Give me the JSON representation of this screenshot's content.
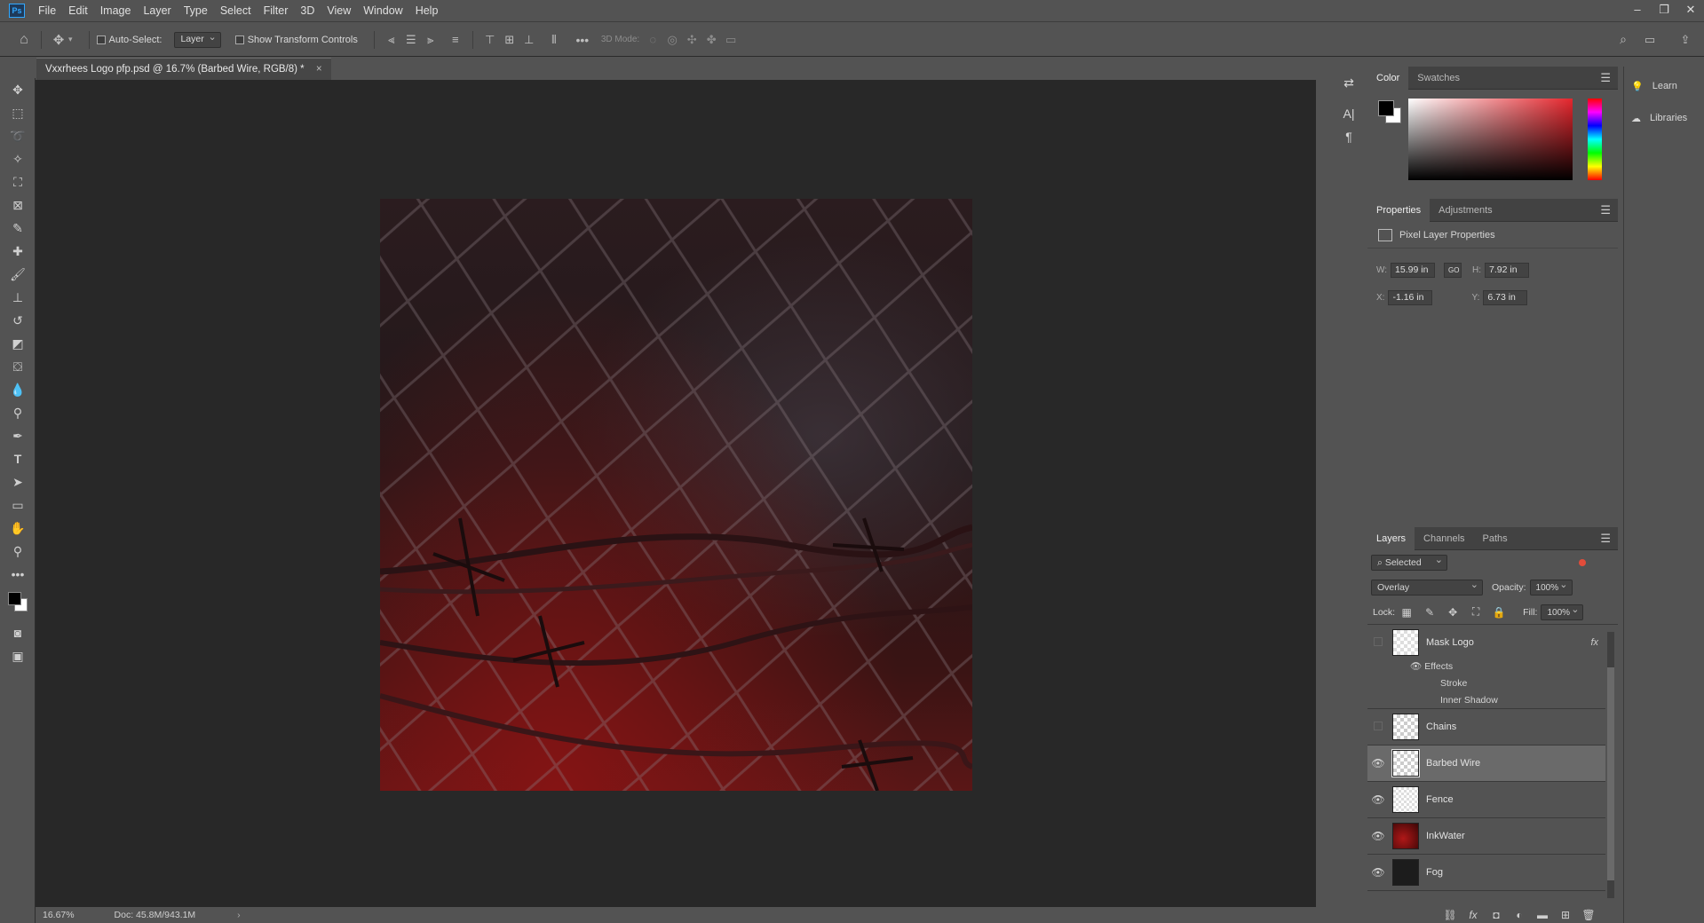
{
  "menubar": {
    "items": [
      "File",
      "Edit",
      "Image",
      "Layer",
      "Type",
      "Select",
      "Filter",
      "3D",
      "View",
      "Window",
      "Help"
    ],
    "app_badge": "Ps"
  },
  "options_bar": {
    "auto_select_label": "Auto-Select:",
    "auto_select_value": "Layer",
    "show_transform_label": "Show Transform Controls",
    "mode_3d_label": "3D Mode:"
  },
  "document": {
    "tab_title": "Vxxrhees Logo pfp.psd @ 16.7% (Barbed Wire, RGB/8) *",
    "close_glyph": "×"
  },
  "status": {
    "zoom": "16.67%",
    "doc_size": "Doc: 45.8M/943.1M"
  },
  "color_panel": {
    "tabs": [
      "Color",
      "Swatches"
    ],
    "foreground": "#000000",
    "background": "#ffffff",
    "hue_base": "#e5262d"
  },
  "properties_panel": {
    "tabs": [
      "Properties",
      "Adjustments"
    ],
    "heading": "Pixel Layer Properties",
    "w_label": "W:",
    "w_value": "15.99 in",
    "h_label": "H:",
    "h_value": "7.92 in",
    "x_label": "X:",
    "x_value": "-1.16 in",
    "y_label": "Y:",
    "y_value": "6.73 in",
    "link_glyph": "GO"
  },
  "layers_panel": {
    "tabs": [
      "Layers",
      "Channels",
      "Paths"
    ],
    "filter_value": "Selected",
    "blend_mode": "Overlay",
    "opacity_label": "Opacity:",
    "opacity_value": "100%",
    "lock_label": "Lock:",
    "fill_label": "Fill:",
    "fill_value": "100%",
    "layers": [
      {
        "name": "Mask Logo",
        "visible": false,
        "fx": "fx",
        "effects_label": "Effects",
        "effects": [
          "Stroke",
          "Inner Shadow"
        ]
      },
      {
        "name": "Chains",
        "visible": false
      },
      {
        "name": "Barbed Wire",
        "visible": true,
        "selected": true
      },
      {
        "name": "Fence",
        "visible": true
      },
      {
        "name": "InkWater",
        "visible": true
      },
      {
        "name": "Fog",
        "visible": true
      }
    ]
  },
  "right_column": {
    "learn_label": "Learn",
    "libraries_label": "Libraries"
  }
}
